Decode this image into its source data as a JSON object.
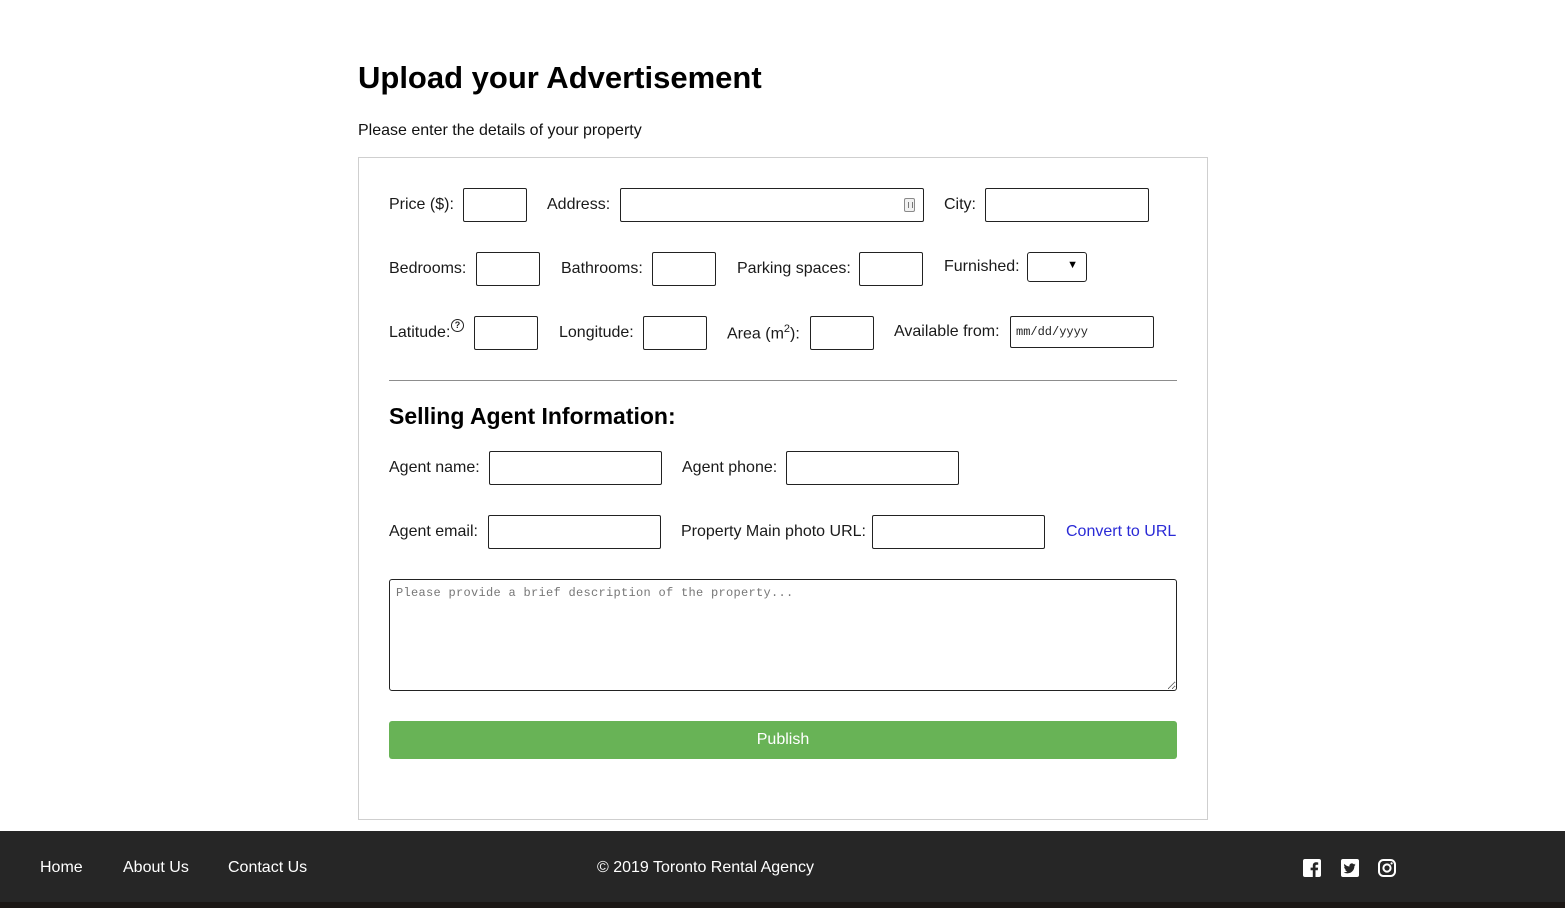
{
  "header": {
    "title": "Upload your Advertisement",
    "subtitle": "Please enter the details of your property"
  },
  "form": {
    "price_label": "Price ($):",
    "address_label": "Address:",
    "city_label": "City:",
    "bedrooms_label": "Bedrooms:",
    "bathrooms_label": "Bathrooms:",
    "parking_label": "Parking spaces:",
    "furnished_label": "Furnished:",
    "furnished_value": "",
    "latitude_label": "Latitude:",
    "latitude_help": "?",
    "longitude_label": "Longitude:",
    "area_label_prefix": "Area (m",
    "area_label_sup": "2",
    "area_label_suffix": "):",
    "available_label": "Available from:",
    "available_placeholder": "mm/dd/yyyy",
    "agent_section_title": "Selling Agent Information:",
    "agent_name_label": "Agent name:",
    "agent_phone_label": "Agent phone:",
    "agent_email_label": "Agent email:",
    "photo_url_label": "Property Main photo URL:",
    "convert_link": "Convert to URL",
    "description_placeholder": "Please provide a brief description of the property...",
    "publish_button": "Publish"
  },
  "footer": {
    "links": [
      "Home",
      "About Us",
      "Contact Us"
    ],
    "copyright": "© 2019 Toronto Rental Agency",
    "social": [
      "facebook-icon",
      "twitter-icon",
      "instagram-icon"
    ]
  },
  "colors": {
    "publish": "#68b356",
    "link": "#2a2ad6",
    "footer_bg": "#262626"
  }
}
